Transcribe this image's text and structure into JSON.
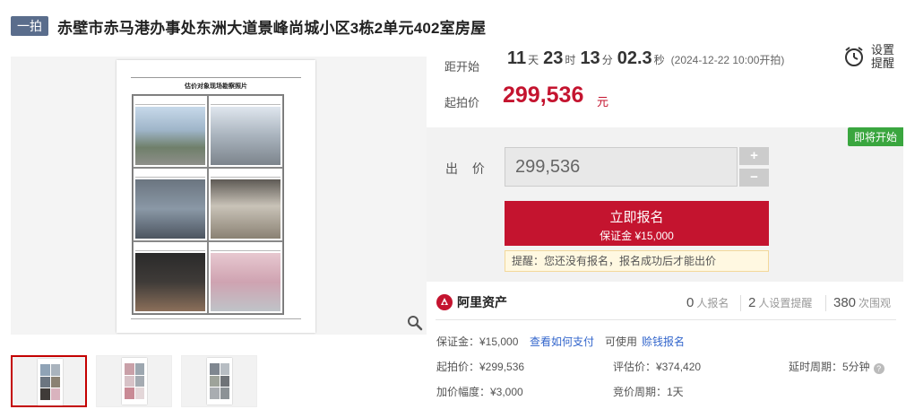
{
  "header": {
    "badge": "一拍",
    "title": "赤壁市赤马港办事处东洲大道景峰尚城小区3栋2单元402室房屋"
  },
  "countdown": {
    "label": "距开始",
    "days": "11",
    "days_unit": "天",
    "hours": "23",
    "hours_unit": "时",
    "minutes": "13",
    "minutes_unit": "分",
    "seconds": "02.3",
    "seconds_unit": "秒",
    "start_time": "(2024-12-22 10:00开拍)"
  },
  "reminder": {
    "label": "设置提醒",
    "icon": "alarm-clock-icon"
  },
  "start_price": {
    "label": "起拍价",
    "value": "299,536",
    "unit": "元"
  },
  "bid": {
    "status_tag": "即将开始",
    "label": "出 价",
    "input_value": "299,536",
    "plus": "+",
    "minus": "−",
    "apply_label": "立即报名",
    "apply_sub": "保证金 ¥15,000",
    "tip": "提醒：您还没有报名，报名成功后才能出价"
  },
  "stats": {
    "brand": "阿里资产",
    "signups": "0",
    "signups_label": "人报名",
    "reminders": "2",
    "reminders_label": "人设置提醒",
    "views": "380",
    "views_label": "次围观"
  },
  "details": {
    "deposit": "保证金：¥15,000",
    "how_to_pay": "查看如何支付",
    "usable": "可使用",
    "earn_link": "赊钱报名",
    "start_price": "起拍价：¥299,536",
    "appraisal": "评估价：¥374,420",
    "delay": "延时周期：5分钟",
    "increment": "加价幅度：¥3,000",
    "cycle": "竞价周期：1天"
  },
  "gallery": {
    "doc_title": "估价对象现场勘察照片",
    "thumbnails": 3
  },
  "colors": {
    "accent": "#c4142f",
    "green": "#3aa63f",
    "link": "#3366cc",
    "badge": "#5a6d8c"
  }
}
